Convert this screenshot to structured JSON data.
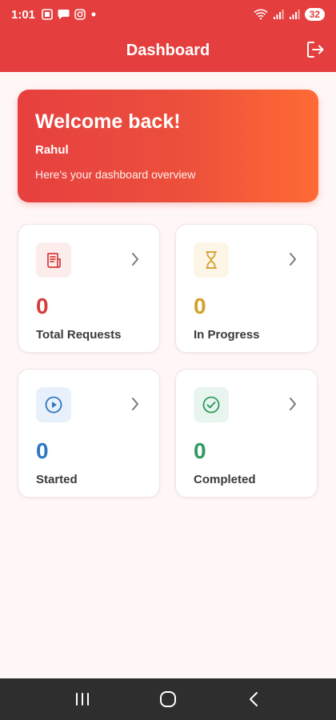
{
  "status_bar": {
    "time": "1:01",
    "battery": "32"
  },
  "app_bar": {
    "title": "Dashboard"
  },
  "welcome": {
    "title": "Welcome back!",
    "name": "Rahul",
    "subtitle": "Here's your dashboard overview"
  },
  "stats": [
    {
      "value": "0",
      "label": "Total Requests",
      "icon": "receipt-icon",
      "color": "#D63B3B",
      "bg": "#FDECEC"
    },
    {
      "value": "0",
      "label": "In Progress",
      "icon": "hourglass-icon",
      "color": "#D4A02A",
      "bg": "#FDF5E6"
    },
    {
      "value": "0",
      "label": "Started",
      "icon": "play-circle-icon",
      "color": "#2F76C0",
      "bg": "#E8F1FB"
    },
    {
      "value": "0",
      "label": "Completed",
      "icon": "check-circle-icon",
      "color": "#2E9A5E",
      "bg": "#E8F5EE"
    }
  ],
  "colors": {
    "primary": "#E53E3E",
    "accent": "#FF6B35",
    "background": "#FFF6F6"
  }
}
